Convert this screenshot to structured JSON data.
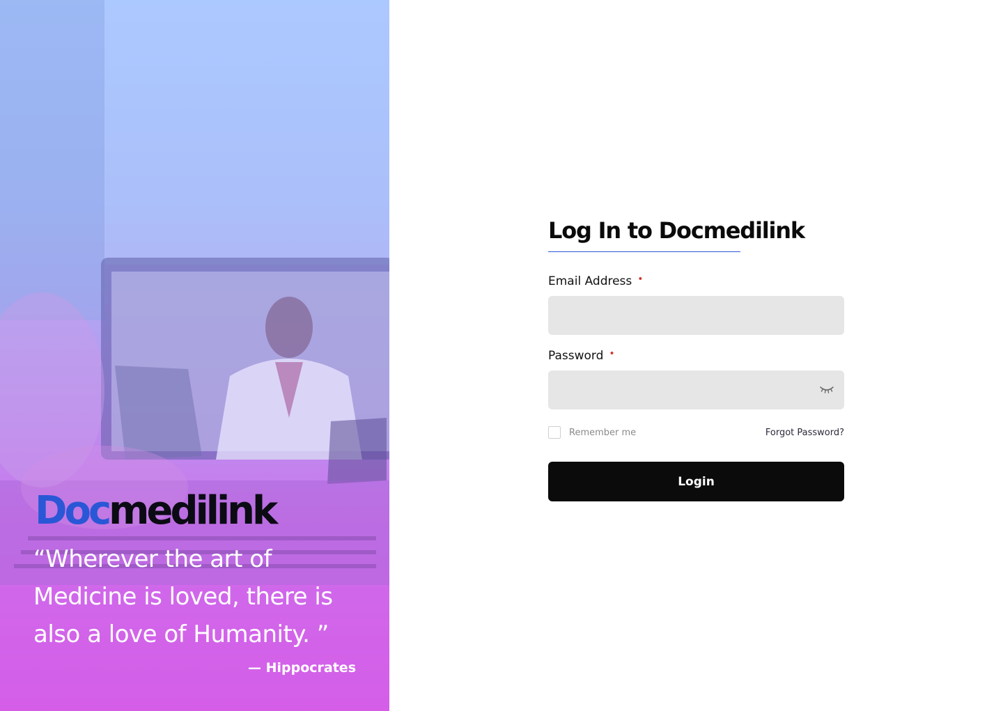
{
  "hero": {
    "brand": {
      "part_a": "Doc",
      "part_b": "medilink"
    },
    "quote": "“Wherever the art of Medicine is loved, there is also a love of Humanity. ”",
    "author": "— Hippocrates",
    "image_description_icon": "doctor-video-call-photo"
  },
  "form": {
    "title": "Log In to Docmedilink",
    "email": {
      "label": "Email Address",
      "required_marker": "•",
      "value": ""
    },
    "password": {
      "label": "Password",
      "required_marker": "•",
      "value": "",
      "toggle_icon": "eye-closed-icon"
    },
    "remember_me": {
      "label": "Remember me",
      "checked": false
    },
    "forgot_password": "Forgot Password?",
    "login_button": "Login"
  },
  "colors": {
    "brand_blue": "#2a57d6",
    "brand_dark": "#0b0b14",
    "required_red": "#d23a2f",
    "input_bg": "#e6e6e6",
    "button_bg": "#0b0b0b",
    "hero_top": "#a8c6ff",
    "hero_bottom": "#d45fe9"
  }
}
